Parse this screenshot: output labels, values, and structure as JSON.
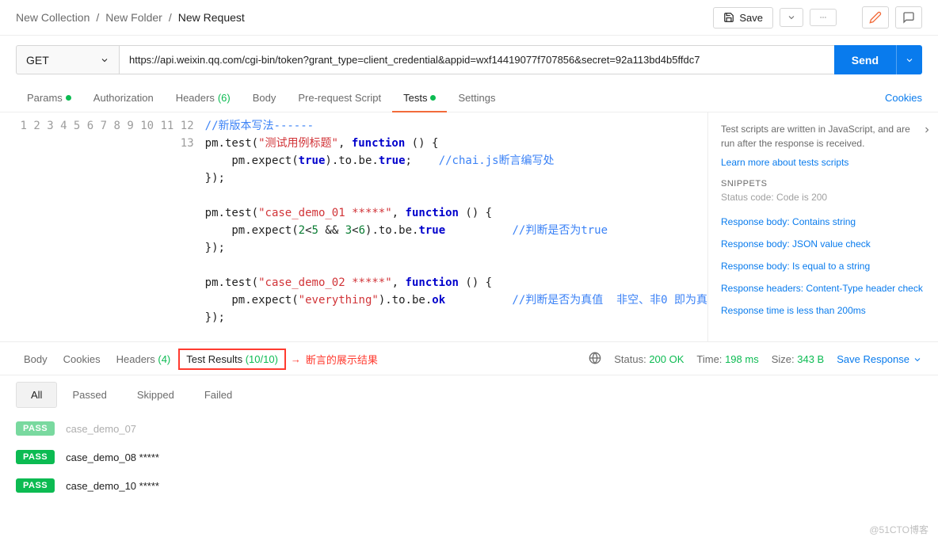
{
  "breadcrumb": [
    "New Collection",
    "New Folder",
    "New Request"
  ],
  "topbar": {
    "save_label": "Save"
  },
  "request": {
    "method": "GET",
    "url": "https://api.weixin.qq.com/cgi-bin/token?grant_type=client_credential&appid=wxf14419077f707856&secret=92a113bd4b5ffdc7",
    "send_label": "Send"
  },
  "tabs": {
    "params": "Params",
    "auth": "Authorization",
    "headers": "Headers",
    "headers_count": "(6)",
    "body": "Body",
    "prereq": "Pre-request Script",
    "tests": "Tests",
    "settings": "Settings",
    "cookies": "Cookies"
  },
  "code_lines": [
    "//新版本写法------",
    "pm.test(\"测试用例标题\", function () {",
    "    pm.expect(true).to.be.true;    //chai.js断言编写处",
    "});",
    "",
    "pm.test(\"case_demo_01 *****\", function () {",
    "    pm.expect(2<5 && 3<6).to.be.true          //判断是否为true",
    "});",
    "",
    "pm.test(\"case_demo_02 *****\", function () {",
    "    pm.expect(\"everything\").to.be.ok          //判断是否为真值  非空、非0 即为真",
    "});",
    ""
  ],
  "side": {
    "help1": "Test scripts are written in JavaScript, and are run after the response is received.",
    "learn": "Learn more about tests scripts",
    "snip_header": "SNIPPETS",
    "snip_sub": "Status code: Code is 200",
    "snippets": [
      "Response body: Contains string",
      "Response body: JSON value check",
      "Response body: Is equal to a string",
      "Response headers: Content-Type header check",
      "Response time is less than 200ms"
    ]
  },
  "results_tabs": {
    "body": "Body",
    "cookies": "Cookies",
    "headers": "Headers",
    "headers_count": "(4)",
    "tests": "Test Results",
    "tests_count": "(10/10)"
  },
  "annotation": "断言的展示结果",
  "status": {
    "status_label": "Status:",
    "status_value": "200 OK",
    "time_label": "Time:",
    "time_value": "198 ms",
    "size_label": "Size:",
    "size_value": "343 B",
    "save_response": "Save Response"
  },
  "filters": [
    "All",
    "Passed",
    "Skipped",
    "Failed"
  ],
  "results": [
    {
      "badge": "PASS",
      "name": "case_demo_07",
      "faded": true
    },
    {
      "badge": "PASS",
      "name": "case_demo_08 *****",
      "faded": false
    },
    {
      "badge": "PASS",
      "name": "case_demo_10 *****",
      "faded": false
    }
  ],
  "watermark": "@51CTO博客"
}
